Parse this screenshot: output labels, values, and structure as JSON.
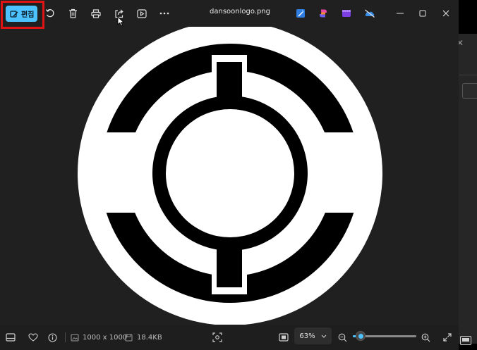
{
  "toolbar": {
    "edit_label": "편집",
    "file_title": "dansoonlogo.png",
    "icons": {
      "edit": "edit-image-icon",
      "rotate": "rotate-icon",
      "delete": "trash-icon",
      "print": "print-icon",
      "share": "share-icon",
      "slideshow": "slideshow-icon",
      "more": "more-icon",
      "designer": "designer-app-icon",
      "copilot": "copilot-app-icon",
      "clipchamp": "clipchamp-app-icon",
      "onedrive": "onedrive-icon"
    }
  },
  "statusbar": {
    "dimensions": "1000 x 1000",
    "file_size": "18.4KB",
    "zoom": "63%",
    "zoom_level": 0.63
  },
  "colors": {
    "accent": "#4cc2ff",
    "highlight_box": "#e01414",
    "window_bg": "#202020"
  }
}
